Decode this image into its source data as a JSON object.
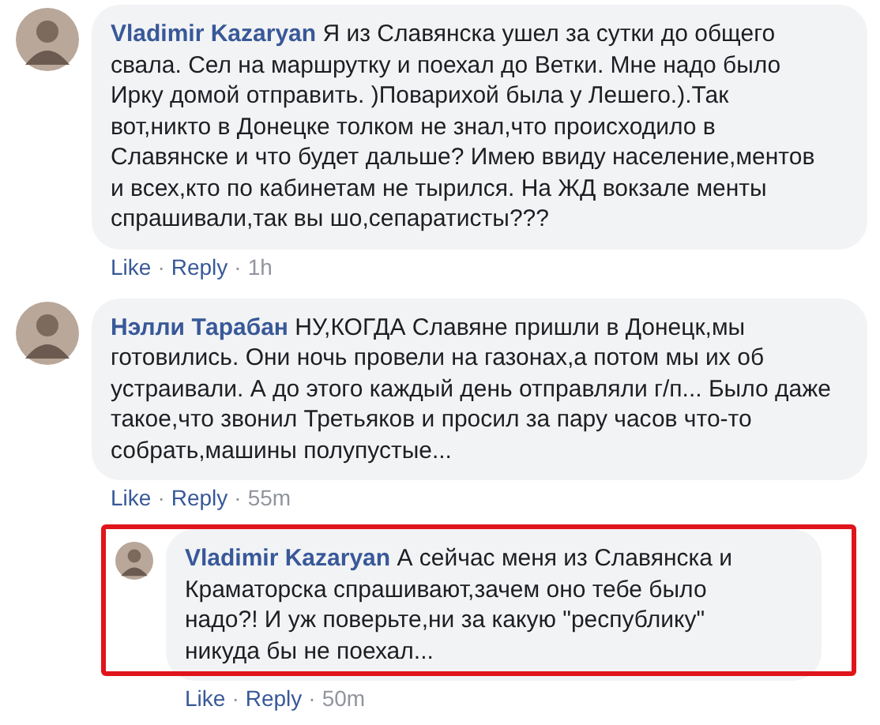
{
  "comments": [
    {
      "author": "Vladimir Kazaryan",
      "text": "Я из Славянска ушел за сутки до общего свала. Сел на маршрутку и поехал до Ветки. Мне надо было Ирку домой отправить. )Поварихой была у Лешего.).Так вот,никто в Донецке толком не знал,что происходило в Славянске и что будет дальше? Имею ввиду население,ментов и всех,кто по кабинетам не тырился. На ЖД вокзале менты спрашивали,так вы шо,сепаратисты???",
      "actions": [
        "Like",
        "Reply"
      ],
      "separator": "·",
      "time": "1h"
    },
    {
      "author": "Нэлли Тарабан",
      "text": "НУ,КОГДА Славяне пришли в Донецк,мы готовились. Они ночь провели на газонах,а потом мы их об устраивали. А до этого каждый день отправляли г/п... Было даже такое,что звонил Третьяков и просил за пару часов что-то собрать,машины полупустые...",
      "actions": [
        "Like",
        "Reply"
      ],
      "separator": "·",
      "time": "55m",
      "children": [
        {
          "author": "Vladimir Kazaryan",
          "text": "А сейчас меня из Славянска и Краматорска спрашивают,зачем оно тебе было надо?! И уж поверьте,ни за какую \"республику\" никуда бы не поехал...",
          "actions": [
            "Like",
            "Reply"
          ],
          "separator": "·",
          "time": "50m",
          "highlighted": true
        }
      ]
    }
  ]
}
